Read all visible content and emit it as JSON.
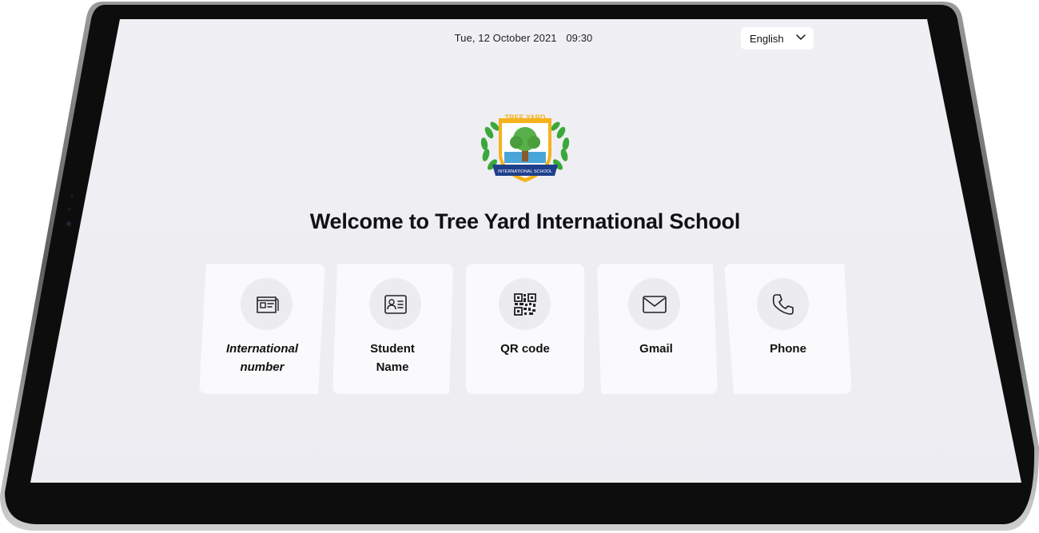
{
  "topbar": {
    "date": "Tue, 12 October 2021",
    "time": "09:30",
    "language": "English"
  },
  "logo": {
    "text_top": "TREE YARD",
    "text_banner": "INTERNATIONAL SCHOOL"
  },
  "welcome_title": "Welcome to Tree Yard International School",
  "login_options": [
    {
      "label_line1": "International",
      "label_line2": "number",
      "icon": "id-card-icon"
    },
    {
      "label_line1": "Student",
      "label_line2": "Name",
      "icon": "contact-card-icon"
    },
    {
      "label_line1": "QR code",
      "label_line2": "",
      "icon": "qr-code-icon"
    },
    {
      "label_line1": "Gmail",
      "label_line2": "",
      "icon": "mail-icon"
    },
    {
      "label_line1": "Phone",
      "label_line2": "",
      "icon": "phone-icon"
    }
  ],
  "colors": {
    "screen_bg": "#eeeef2",
    "card_bg": "#fafafc",
    "icon_circle": "#ececf0",
    "bezel": "#111111"
  }
}
